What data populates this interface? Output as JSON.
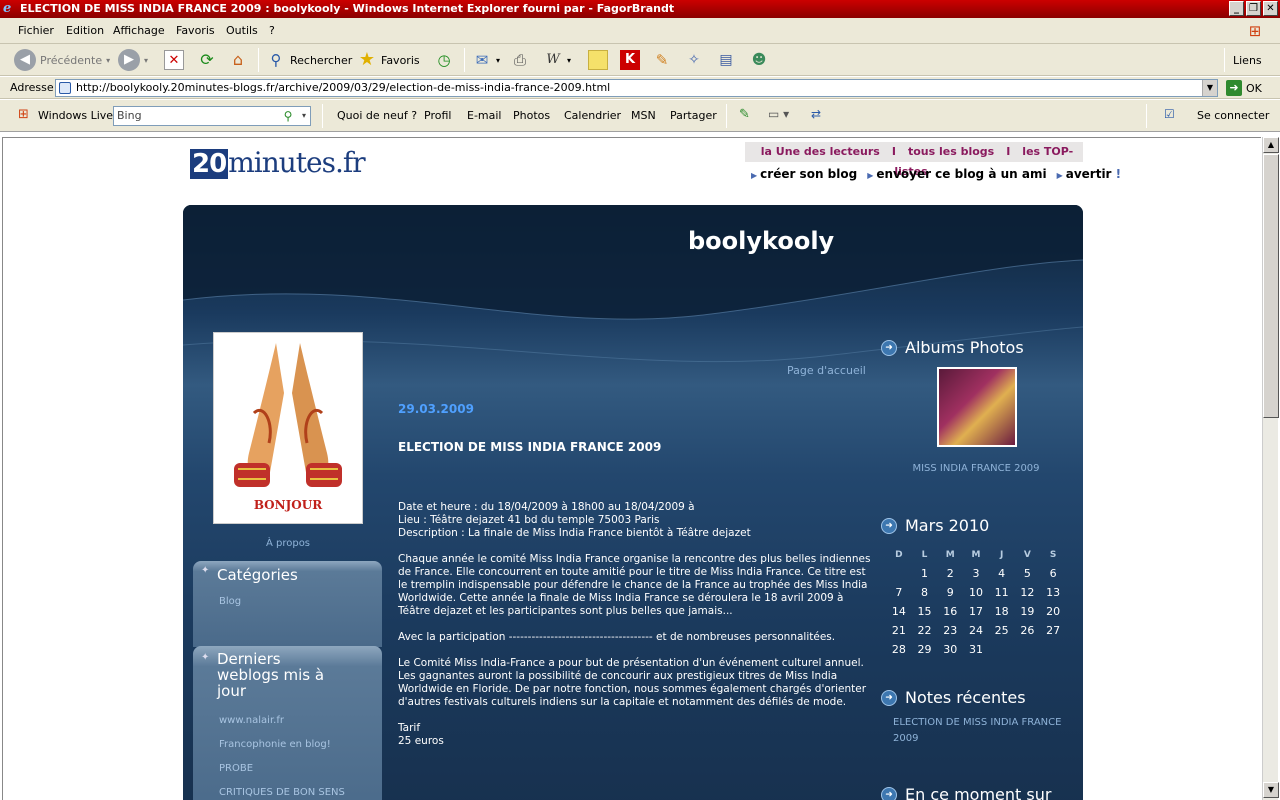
{
  "window": {
    "title": "ELECTION DE MISS INDIA FRANCE 2009 : boolykooly - Windows Internet Explorer fourni par - FagorBrandt"
  },
  "menu": [
    "Fichier",
    "Edition",
    "Affichage",
    "Favoris",
    "Outils",
    "?"
  ],
  "toolbar": {
    "back": "Précédente",
    "search": "Rechercher",
    "favorites": "Favoris",
    "links": "Liens"
  },
  "address": {
    "label": "Adresse",
    "url": "http://boolykooly.20minutes-blogs.fr/archive/2009/03/29/election-de-miss-india-france-2009.html",
    "go": "OK"
  },
  "livebar": {
    "brand": "Windows Live",
    "search_value": "Bing",
    "items": [
      "Quoi de neuf ?",
      "Profil",
      "E-mail",
      "Photos",
      "Calendrier",
      "MSN",
      "Partager"
    ],
    "signin": "Se connecter"
  },
  "site": {
    "logo_num": "20",
    "logo_text": "minutes.fr",
    "top_links": [
      "la Une des lecteurs",
      "tous les blogs",
      "les TOP-listes"
    ],
    "top_sep": "I",
    "action_links": [
      "créer son blog",
      "envoyer ce blog à un ami",
      "avertir"
    ],
    "action_bang": "!"
  },
  "blog": {
    "title": "boolykooly",
    "photo_caption": "BONJOUR",
    "apropos": "À propos",
    "categories": {
      "title": "Catégories",
      "items": [
        "Blog"
      ]
    },
    "recent_blogs": {
      "title": "Derniers weblogs mis à jour",
      "items": [
        "www.nalair.fr",
        "Francophonie en blog!",
        "PROBE",
        "CRITIQUES DE BON SENS"
      ]
    },
    "home_link": "Page d'accueil",
    "post": {
      "date": "29.03.2009",
      "title": "ELECTION DE MISS INDIA FRANCE 2009",
      "info": [
        "Date et heure : du 18/04/2009 à 18h00 au 18/04/2009 à",
        "Lieu : Téâtre dejazet 41 bd du temple 75003 Paris",
        "Description : La finale de Miss India France bientôt à Téâtre dejazet"
      ],
      "p1": "Chaque année le comité Miss India France organise la rencontre des plus belles indiennes de France. Elle concourrent en toute amitié pour le titre de Miss India France. Ce titre est le tremplin indispensable pour défendre le chance de la France au trophée des Miss India Worldwide. Cette année la finale de Miss India France se déroulera le 18 avril 2009 à Téâtre dejazet et les participantes sont plus belles que jamais...",
      "p2": "Avec la participation -------------------------------------- et de nombreuses personnalitées.",
      "p3": "Le Comité Miss India-France a pour but de présentation d'un événement culturel annuel. Les gagnantes auront la possibilité de concourir aux prestigieux titres de Miss India Worldwide en Floride. De par notre fonction, nous sommes également chargés d'orienter d'autres festivals culturels indiens sur la capitale et notamment des défilés de mode.",
      "tarif_label": "Tarif",
      "tarif_value": "25 euros"
    },
    "albums": {
      "title": "Albums Photos",
      "caption": "MISS INDIA FRANCE 2009"
    },
    "calendar": {
      "title": "Mars 2010",
      "days": [
        "D",
        "L",
        "M",
        "M",
        "J",
        "V",
        "S"
      ],
      "weeks": [
        [
          "",
          "1",
          "2",
          "3",
          "4",
          "5",
          "6"
        ],
        [
          "7",
          "8",
          "9",
          "10",
          "11",
          "12",
          "13"
        ],
        [
          "14",
          "15",
          "16",
          "17",
          "18",
          "19",
          "20"
        ],
        [
          "21",
          "22",
          "23",
          "24",
          "25",
          "26",
          "27"
        ],
        [
          "28",
          "29",
          "30",
          "31",
          "",
          "",
          ""
        ]
      ]
    },
    "notes": {
      "title": "Notes récentes",
      "items": [
        "ELECTION DE MISS INDIA FRANCE 2009"
      ]
    },
    "now_title": "En ce moment sur"
  }
}
